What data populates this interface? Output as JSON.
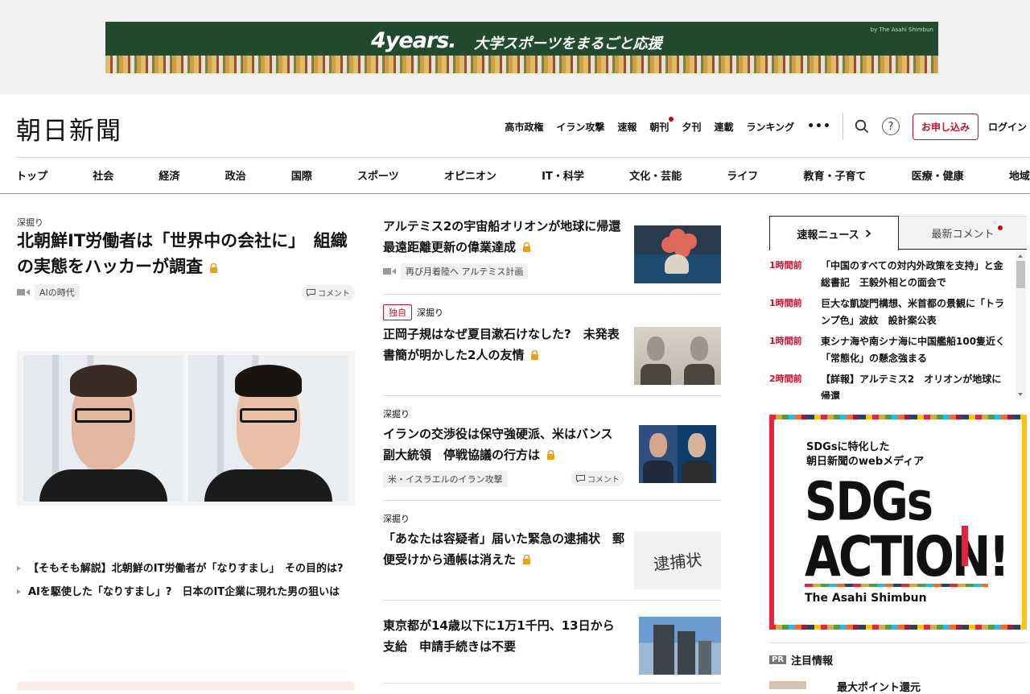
{
  "ad_banner": {
    "brand": "4years.",
    "text": "大学スポーツをまるごと応援",
    "by": "by The Asahi Shimbun"
  },
  "header": {
    "logo": "朝日新聞",
    "util_links": [
      {
        "label": "高市政権",
        "dot": false
      },
      {
        "label": "イラン攻撃",
        "dot": false
      },
      {
        "label": "速報",
        "dot": false
      },
      {
        "label": "朝刊",
        "dot": true
      },
      {
        "label": "夕刊",
        "dot": false
      },
      {
        "label": "連載",
        "dot": false
      },
      {
        "label": "ランキング",
        "dot": false
      }
    ],
    "more": "•••",
    "help": "?",
    "subscribe": "お申し込み",
    "login": "ログイン"
  },
  "main_nav": [
    "トップ",
    "社会",
    "経済",
    "政治",
    "国際",
    "スポーツ",
    "オピニオン",
    "IT・科学",
    "文化・芸能",
    "ライフ",
    "教育・子育て",
    "医療・健康",
    "地域"
  ],
  "lead": {
    "kicker": "深掘り",
    "title": "北朝鮮IT労働者は「世界中の会社に」　組織の実態をハッカーが調査",
    "tag": "AIの時代",
    "comment": "コメント",
    "related": [
      "【そもそも解説】北朝鮮のIT労働者が「なりすまし」　その目的は?",
      "AIを駆使した「なりすまし」?　日本のIT企業に現れた男の狙いは"
    ]
  },
  "mid_stories": [
    {
      "title": "アルテミス2の宇宙船オリオンが地球に帰還　最遠距離更新の偉業達成",
      "locked": true,
      "tag": "再び月着陸へ アルテミス計画"
    },
    {
      "exclusive": "独自",
      "kicker": "深掘り",
      "title": "正岡子規はなぜ夏目漱石けなした?　未発表書簡が明かした2人の友情",
      "locked": true
    },
    {
      "kicker": "深掘り",
      "title": "イランの交渉役は保守強硬派、米はバンス副大統領　停戦協議の行方は",
      "locked": true,
      "tag": "米・イスラエルのイラン攻撃",
      "comment": "コメント"
    },
    {
      "kicker": "深掘り",
      "title": "「あなたは容疑者」届いた緊急の逮捕状　郵便受けから通帳は消えた",
      "locked": true,
      "thumb_text": "逮捕状"
    },
    {
      "title": "東京都が14歳以下に1万1千円、13日から支給　申請手続きは不要",
      "locked": false
    }
  ],
  "tabs": {
    "breaking": "速報ニュース",
    "comments": "最新コメント"
  },
  "breaking_news": [
    {
      "time": "1時間前",
      "text": "「中国のすべての対内外政策を支持」と金総書記　王毅外相との面会で"
    },
    {
      "time": "1時間前",
      "text": "巨大な凱旋門構想、米首都の景観に「トランプ色」波紋　設計案公表"
    },
    {
      "time": "1時間前",
      "text": "東シナ海や南シナ海に中国艦船100隻近く　「常態化」の懸念強まる"
    },
    {
      "time": "2時間前",
      "text": "【詳報】アルテミス2　オリオンが地球に帰還"
    }
  ],
  "sdgs_ad": {
    "subtitle_line1": "SDGsに特化した",
    "subtitle_line2": "朝日新聞のwebメディア",
    "big1": "SDGs",
    "big2": "ACTION!",
    "brand": "The Asahi Shimbun"
  },
  "pr": {
    "badge": "PR",
    "label": "注目情報",
    "item": "最大ポイント還元"
  }
}
